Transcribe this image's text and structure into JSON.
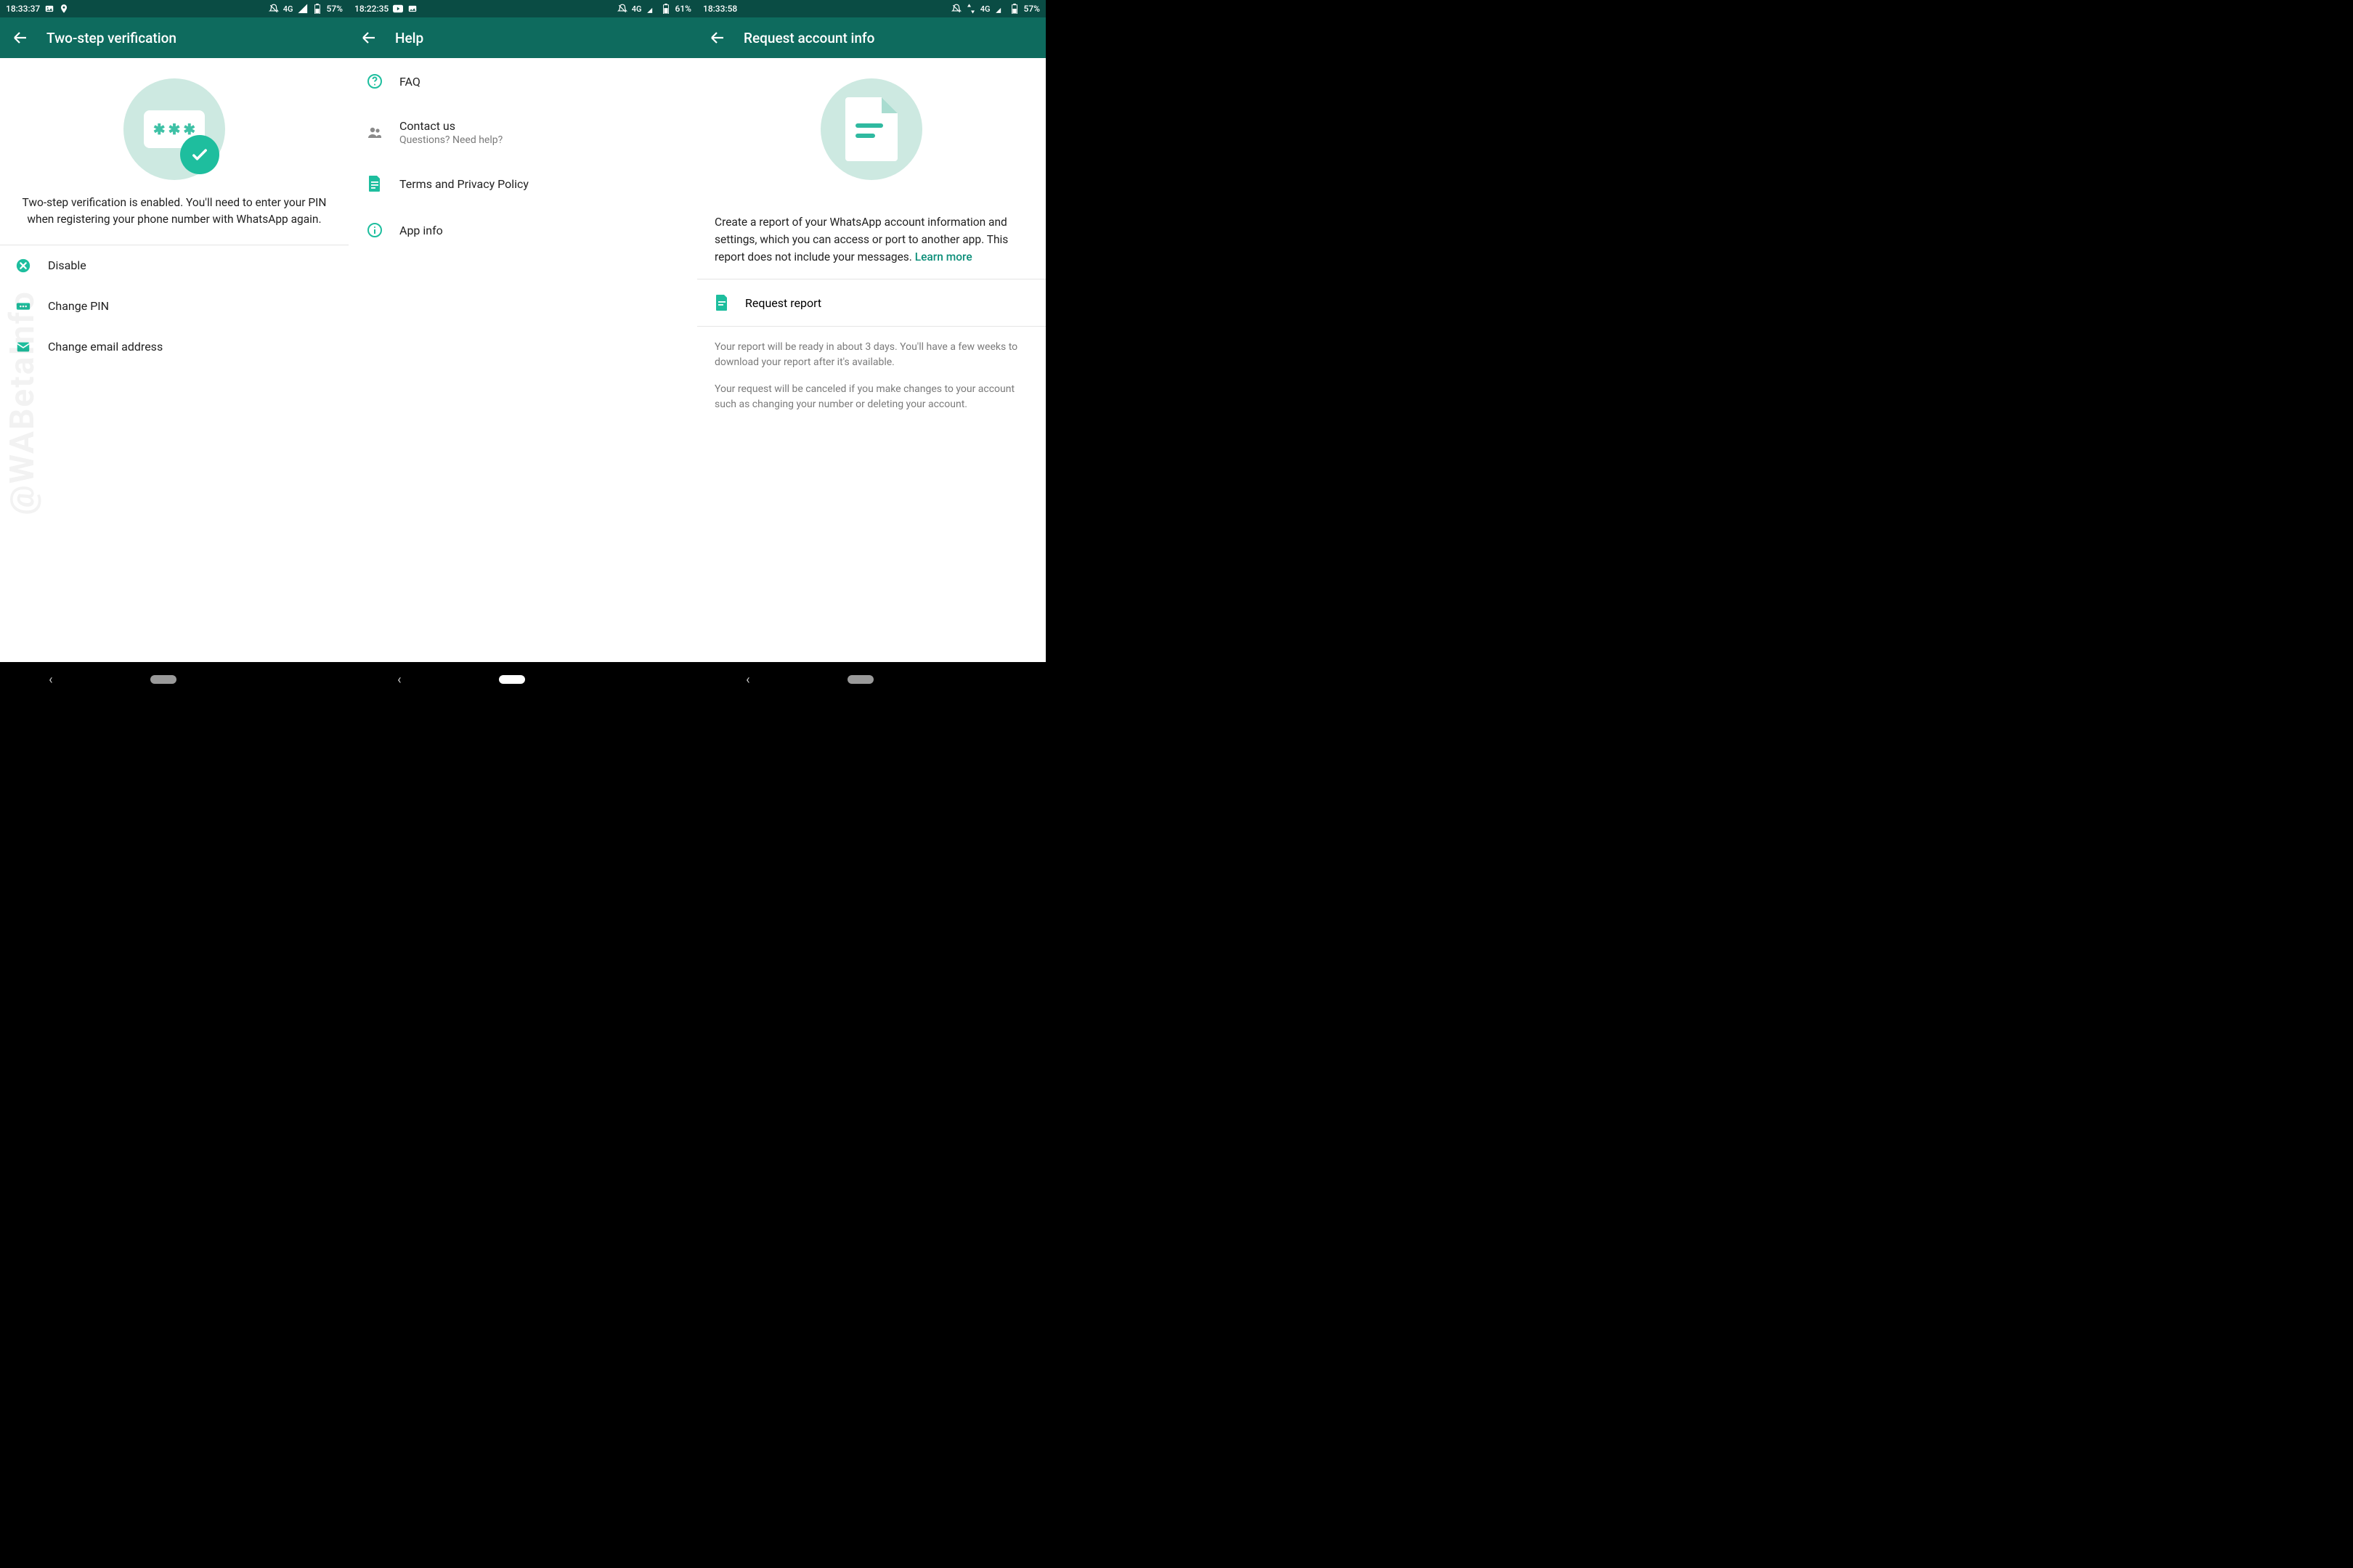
{
  "colors": {
    "brand": "#0e6b5e",
    "accent": "#1ebe9e",
    "link": "#0e8f7a"
  },
  "screens": [
    {
      "statusbar": {
        "time": "18:33:37",
        "network": "4G",
        "battery": "57%"
      },
      "title": "Two-step verification",
      "desc": "Two-step verification is enabled. You'll need to enter your PIN when registering your phone number with WhatsApp again.",
      "items": [
        {
          "icon": "close-circle",
          "label": "Disable"
        },
        {
          "icon": "dots-box",
          "label": "Change PIN"
        },
        {
          "icon": "mail",
          "label": "Change email address"
        }
      ]
    },
    {
      "statusbar": {
        "time": "18:22:35",
        "network": "4G",
        "battery": "61%"
      },
      "title": "Help",
      "items": [
        {
          "icon": "help-circle",
          "label": "FAQ"
        },
        {
          "icon": "people",
          "label": "Contact us",
          "sub": "Questions? Need help?"
        },
        {
          "icon": "doc",
          "label": "Terms and Privacy Policy"
        },
        {
          "icon": "info-circle",
          "label": "App info"
        }
      ]
    },
    {
      "statusbar": {
        "time": "18:33:58",
        "network": "4G",
        "battery": "57%"
      },
      "title": "Request account info",
      "desc": "Create a report of your WhatsApp account information and settings, which you can access or port to another app. This report does not include your messages. ",
      "learn_more": "Learn more",
      "request_label": "Request report",
      "foot1": "Your report will be ready in about 3 days. You'll have a few weeks to download your report after it's available.",
      "foot2": "Your request will be canceled if you make changes to your account such as changing your number or deleting your account."
    }
  ],
  "watermark": "@WABetaInfo"
}
